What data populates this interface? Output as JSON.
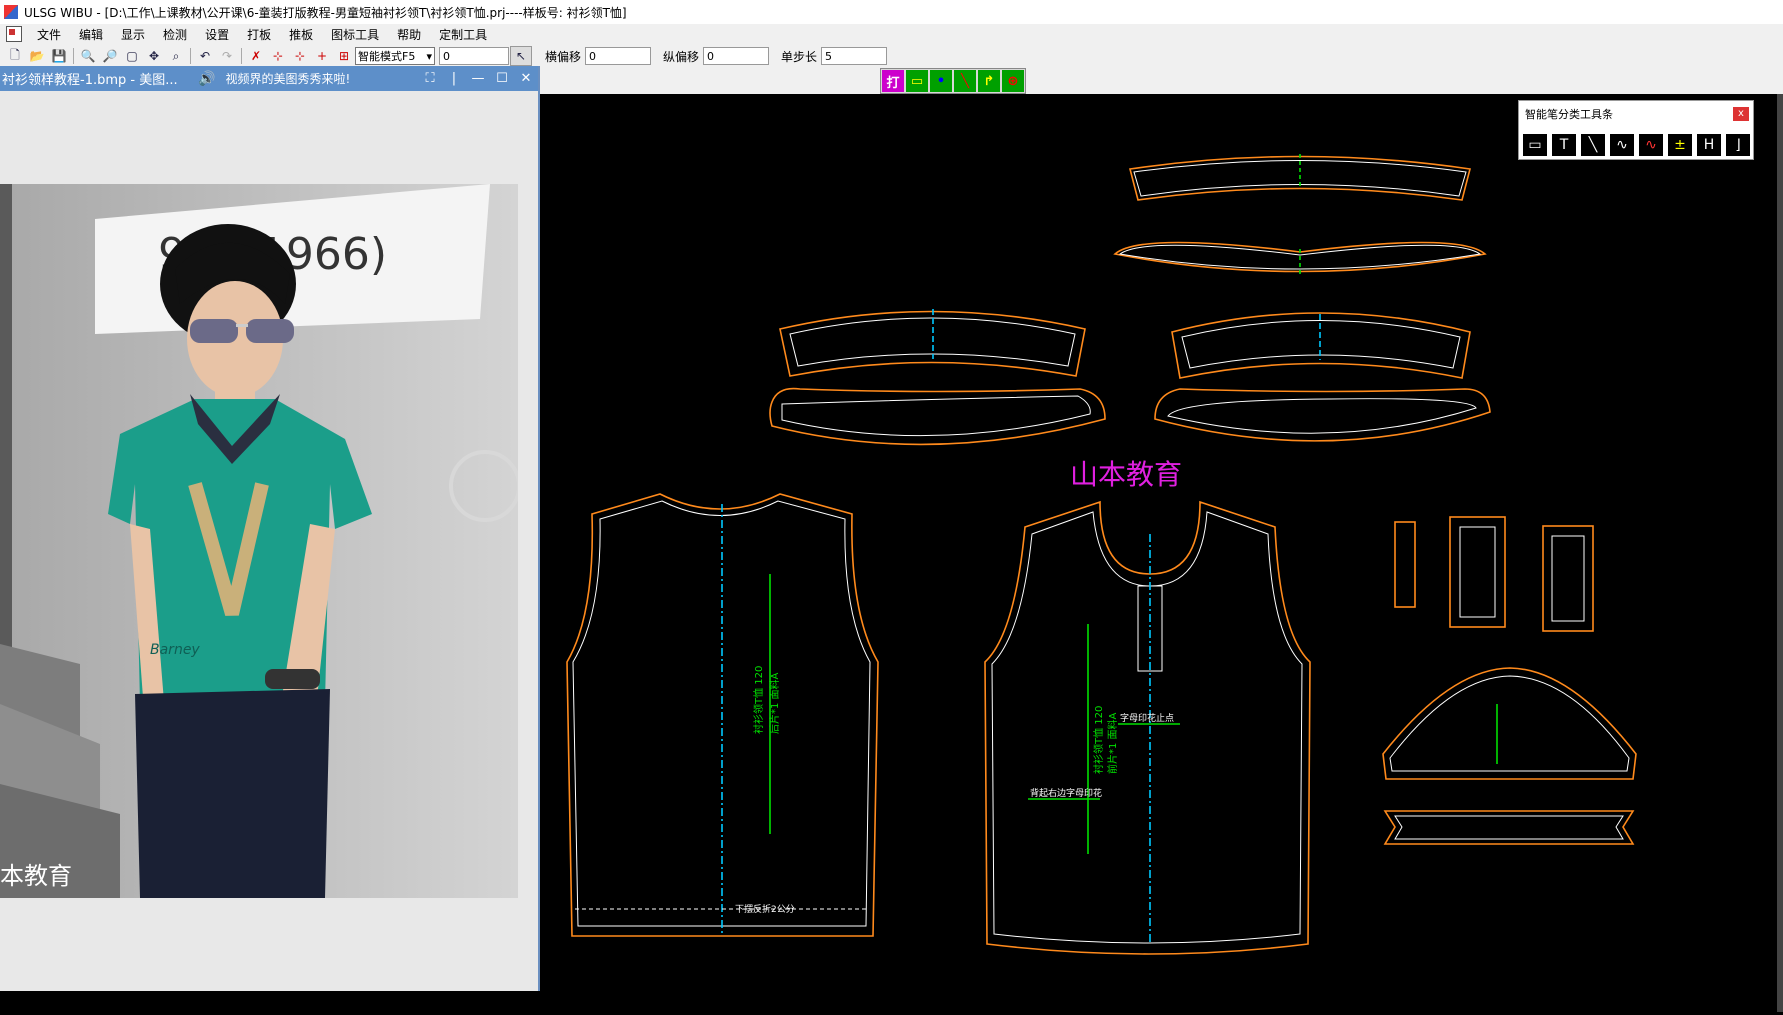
{
  "window": {
    "title": "ULSG WIBU - [D:\\工作\\上课教材\\公开课\\6-童装打版教程-男童短袖衬衫领T\\衬衫领T恤.prj----样板号: 衬衫领T恤]"
  },
  "menu": [
    "文件",
    "编辑",
    "显示",
    "检测",
    "设置",
    "打板",
    "推板",
    "图标工具",
    "帮助",
    "定制工具"
  ],
  "toolbar": {
    "mode_select": "智能模式F5",
    "value_input": "0",
    "h_offset_label": "横偏移",
    "h_offset_value": "0",
    "v_offset_label": "纵偏移",
    "v_offset_value": "0",
    "step_label": "单步长",
    "step_value": "5"
  },
  "color_toolbar": {
    "first_label": "打"
  },
  "left_window": {
    "title": "衬衫领样教程-1.bmp - 美图...",
    "notice": "视频界的美图秀秀来啦!",
    "photo_wall_text": "901-1966)",
    "photo_watermark": "本教育",
    "shirt_script": "Barney"
  },
  "palette": {
    "title": "智能笔分类工具条",
    "close": "x"
  },
  "canvas": {
    "watermark": "山本教育",
    "back_piece_labels": [
      "衬衫领T恤 120",
      "后片*1 面料A",
      "下摆反折2公分"
    ],
    "front_piece_labels": [
      "衬衫领T恤 120",
      "前片*1 面料A",
      "字母印花止点",
      "背起右边字母印花"
    ]
  },
  "colors": {
    "outline_orange": "#ff8a1c",
    "inner_white": "#ffffff",
    "grain_green": "#00e000",
    "center_cyan": "#00c8ff",
    "watermark_magenta": "#e020e0"
  }
}
